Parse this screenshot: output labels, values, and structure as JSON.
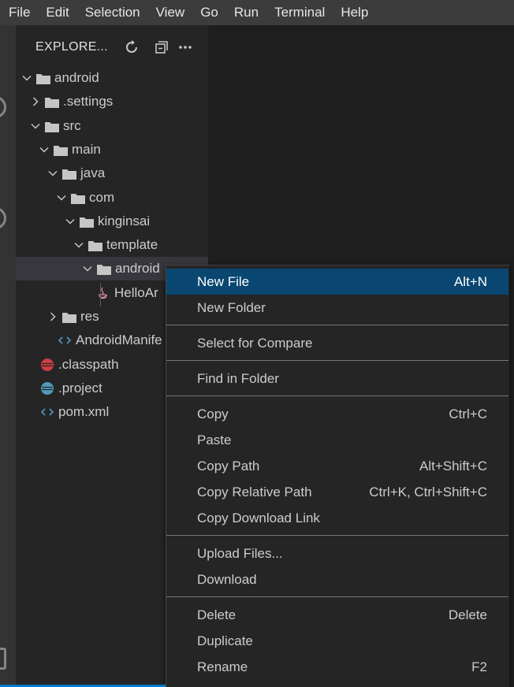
{
  "menubar": {
    "items": [
      "File",
      "Edit",
      "Selection",
      "View",
      "Go",
      "Run",
      "Terminal",
      "Help"
    ]
  },
  "explorer": {
    "title": "EXPLORE...",
    "actions": [
      "refresh-icon",
      "collapse-all-icon",
      "more-actions-icon"
    ]
  },
  "tree": [
    {
      "label": "android",
      "depth": 0,
      "type": "folder",
      "expanded": true
    },
    {
      "label": ".settings",
      "depth": 1,
      "type": "folder",
      "expanded": false
    },
    {
      "label": "src",
      "depth": 1,
      "type": "folder",
      "expanded": true
    },
    {
      "label": "main",
      "depth": 2,
      "type": "folder",
      "expanded": true
    },
    {
      "label": "java",
      "depth": 3,
      "type": "folder",
      "expanded": true
    },
    {
      "label": "com",
      "depth": 4,
      "type": "folder",
      "expanded": true
    },
    {
      "label": "kinginsai",
      "depth": 5,
      "type": "folder",
      "expanded": true
    },
    {
      "label": "template",
      "depth": 6,
      "type": "folder",
      "expanded": true
    },
    {
      "label": "android",
      "depth": 7,
      "type": "folder",
      "expanded": true,
      "selected": true
    },
    {
      "label": "HelloAr",
      "depth": 8,
      "type": "java"
    },
    {
      "label": "res",
      "depth": 3,
      "type": "folder",
      "expanded": false
    },
    {
      "label": "AndroidManife",
      "depth": 3,
      "type": "xml"
    },
    {
      "label": ".classpath",
      "depth": 1,
      "type": "classpath"
    },
    {
      "label": ".project",
      "depth": 1,
      "type": "project"
    },
    {
      "label": "pom.xml",
      "depth": 1,
      "type": "xml"
    }
  ],
  "context_menu": {
    "groups": [
      [
        {
          "label": "New File",
          "shortcut": "Alt+N",
          "active": true
        },
        {
          "label": "New Folder",
          "shortcut": ""
        }
      ],
      [
        {
          "label": "Select for Compare",
          "shortcut": ""
        }
      ],
      [
        {
          "label": "Find in Folder",
          "shortcut": ""
        }
      ],
      [
        {
          "label": "Copy",
          "shortcut": "Ctrl+C"
        },
        {
          "label": "Paste",
          "shortcut": ""
        },
        {
          "label": "Copy Path",
          "shortcut": "Alt+Shift+C"
        },
        {
          "label": "Copy Relative Path",
          "shortcut": "Ctrl+K, Ctrl+Shift+C"
        },
        {
          "label": "Copy Download Link",
          "shortcut": ""
        }
      ],
      [
        {
          "label": "Upload Files...",
          "shortcut": ""
        },
        {
          "label": "Download",
          "shortcut": ""
        }
      ],
      [
        {
          "label": "Delete",
          "shortcut": "Delete"
        },
        {
          "label": "Duplicate",
          "shortcut": ""
        },
        {
          "label": "Rename",
          "shortcut": "F2"
        }
      ]
    ]
  },
  "colors": {
    "menubar_bg": "#3c3c3c",
    "sidebar_bg": "#252526",
    "editor_bg": "#1e1e1e",
    "menu_active": "#094771",
    "accent": "#007acc"
  }
}
